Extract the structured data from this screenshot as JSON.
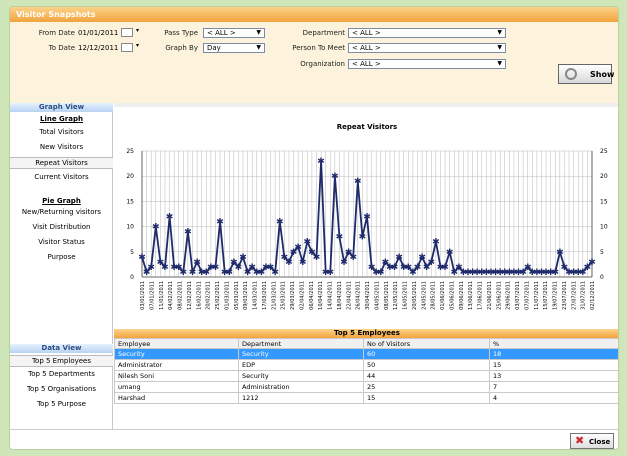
{
  "window": {
    "title": "Visitor Snapshots"
  },
  "filters": {
    "from_date_label": "From Date",
    "from_date_value": "01/01/2011",
    "to_date_label": "To Date",
    "to_date_value": "12/12/2011",
    "pass_type_label": "Pass Type",
    "pass_type_value": "< ALL >",
    "graph_by_label": "Graph By",
    "graph_by_value": "Day",
    "department_label": "Department",
    "department_value": "< ALL >",
    "person_label": "Person To Meet",
    "person_value": "< ALL >",
    "organization_label": "Organization",
    "organization_value": "< ALL >",
    "show_label": "Show"
  },
  "graph_view": {
    "header": "Graph View",
    "line_graph": "Line Graph",
    "items_line": [
      "Total Visitors",
      "New Visitors",
      "Repeat Visitors",
      "Current Visitors"
    ],
    "pie_graph": "Pie Graph",
    "items_pie": [
      "New/Returning visitors",
      "Visit Distribution",
      "Visitor Status",
      "Purpose"
    ]
  },
  "data_view": {
    "header": "Data View",
    "items": [
      "Top 5 Employees",
      "Top 5 Departments",
      "Top 5 Organisations",
      "Top 5 Purpose"
    ]
  },
  "chart_data": {
    "type": "line",
    "title": "Repeat Visitors",
    "ylim": [
      0,
      25
    ],
    "yticks": [
      0,
      5,
      10,
      15,
      20,
      25
    ],
    "grid": true,
    "legend": "none",
    "color": "#1f2a6b",
    "values": [
      4,
      1,
      2,
      10,
      3,
      2,
      12,
      2,
      2,
      1,
      9,
      1,
      3,
      1,
      1,
      2,
      2,
      11,
      1,
      1,
      3,
      2,
      4,
      1,
      2,
      1,
      1,
      2,
      2,
      1,
      11,
      4,
      3,
      5,
      6,
      3,
      7,
      5,
      4,
      23,
      1,
      1,
      20,
      8,
      3,
      5,
      4,
      19,
      8,
      12,
      2,
      1,
      1,
      3,
      2,
      2,
      4,
      2,
      2,
      1,
      2,
      4,
      2,
      3,
      7,
      2,
      2,
      5,
      1,
      2,
      1,
      1,
      1,
      1,
      1,
      1,
      1,
      1,
      1,
      1,
      1,
      1,
      1,
      1,
      2,
      1,
      1,
      1,
      1,
      1,
      1,
      5,
      2,
      1,
      1,
      1,
      1,
      2,
      3
    ],
    "xticklabels": [
      "03/01/2011",
      "07/01/2011",
      "11/01/2011",
      "04/02/2011",
      "08/02/2011",
      "12/02/2011",
      "16/02/2011",
      "20/02/2011",
      "25/02/2011",
      "01/03/2011",
      "05/03/2011",
      "09/03/2011",
      "14/03/2011",
      "17/03/2011",
      "21/03/2011",
      "25/03/2011",
      "29/03/2011",
      "02/04/2011",
      "06/04/2011",
      "10/04/2011",
      "14/04/2011",
      "18/04/2011",
      "22/04/2011",
      "26/04/2011",
      "30/04/2011",
      "04/05/2011",
      "08/05/2011",
      "12/05/2011",
      "16/05/2011",
      "20/05/2011",
      "24/05/2011",
      "28/05/2011",
      "01/06/2011",
      "05/06/2011",
      "09/06/2011",
      "13/06/2011",
      "17/06/2011",
      "21/06/2011",
      "25/06/2011",
      "29/06/2011",
      "03/07/2011",
      "07/07/2011",
      "11/07/2011",
      "15/07/2011",
      "19/07/2011",
      "23/07/2011",
      "27/07/2011",
      "31/07/2011",
      "02/12/2011"
    ]
  },
  "grid": {
    "title": "Top 5 Employees",
    "columns": [
      "Employee",
      "Department",
      "No of Visitors",
      "%"
    ],
    "rows": [
      [
        "Security",
        "Security",
        "60",
        "18"
      ],
      [
        "Administrator",
        "EDP",
        "50",
        "15"
      ],
      [
        "Nilesh Soni",
        "Security",
        "44",
        "13"
      ],
      [
        "umang",
        "Administration",
        "25",
        "7"
      ],
      [
        "Harshad",
        "1212",
        "15",
        "4"
      ]
    ]
  },
  "footer": {
    "close_label": "Close"
  }
}
